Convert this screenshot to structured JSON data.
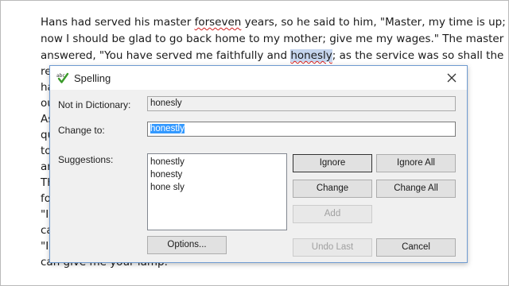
{
  "document": {
    "line1": {
      "a": "Hans had served his master ",
      "sq": "forseven",
      "b": " years, so he said to him, \"Master, my time is up;"
    },
    "line2": "now I should be glad to go back home to my mother; give me my wages.\" The master",
    "line3": {
      "a": "answered, \"You have served me faithfully and ",
      "hl": "honesly",
      "b": "; as the service was so shall the"
    },
    "partial_lines": [
      "re",
      "ha",
      "ou",
      "As",
      "qu",
      "to",
      "an",
      "Th",
      "fo",
      "\"I",
      "ca",
      "\"I"
    ],
    "last_line": "can give me your lamp.\""
  },
  "dialog": {
    "title": "Spelling",
    "not_in_dictionary_label": "Not in Dictionary:",
    "not_in_dictionary_value": "honesly",
    "change_to_label": "Change to:",
    "change_to_value": "honestly",
    "suggestions_label": "Suggestions:",
    "suggestions": [
      "honestly",
      "honesty",
      "hone sly"
    ],
    "buttons": {
      "ignore": "Ignore",
      "ignore_all": "Ignore All",
      "change": "Change",
      "change_all": "Change All",
      "add": "Add",
      "options": "Options...",
      "undo_last": "Undo Last",
      "cancel": "Cancel"
    }
  },
  "colors": {
    "selection": "#3399ff",
    "highlight": "#c5d5ee",
    "squiggle": "#d21f1f",
    "dialog_border": "#6f9bd1"
  }
}
